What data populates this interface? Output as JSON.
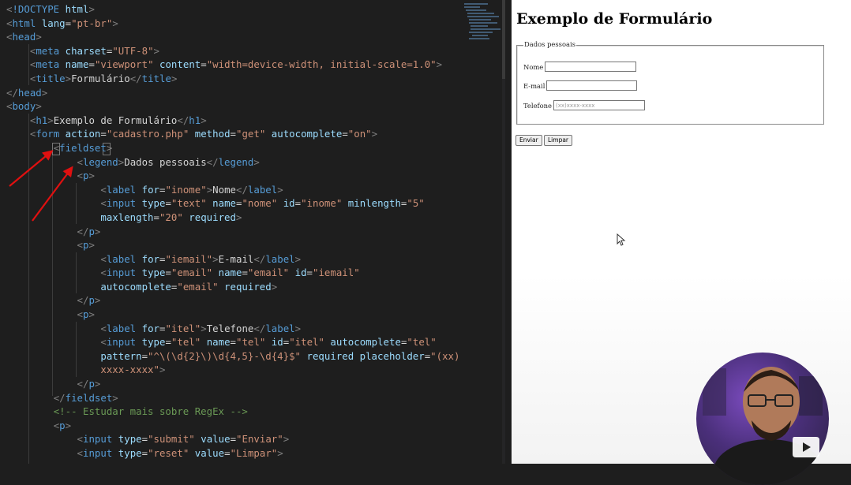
{
  "editor": {
    "lines": [
      [
        {
          "c": "p",
          "v": "<"
        },
        {
          "c": "d",
          "v": "!DOCTYPE"
        },
        {
          "c": "x",
          "v": " "
        },
        {
          "c": "a",
          "v": "html"
        },
        {
          "c": "p",
          "v": ">"
        }
      ],
      [
        {
          "c": "p",
          "v": "<"
        },
        {
          "c": "t",
          "v": "html"
        },
        {
          "c": "x",
          "v": " "
        },
        {
          "c": "a",
          "v": "lang"
        },
        {
          "c": "x",
          "v": "="
        },
        {
          "c": "s",
          "v": "\"pt-br\""
        },
        {
          "c": "p",
          "v": ">"
        }
      ],
      [
        {
          "c": "p",
          "v": "<"
        },
        {
          "c": "t",
          "v": "head"
        },
        {
          "c": "p",
          "v": ">"
        }
      ],
      [
        {
          "c": "x",
          "v": "    "
        },
        {
          "c": "p",
          "v": "<"
        },
        {
          "c": "t",
          "v": "meta"
        },
        {
          "c": "x",
          "v": " "
        },
        {
          "c": "a",
          "v": "charset"
        },
        {
          "c": "x",
          "v": "="
        },
        {
          "c": "s",
          "v": "\"UTF-8\""
        },
        {
          "c": "p",
          "v": ">"
        }
      ],
      [
        {
          "c": "x",
          "v": "    "
        },
        {
          "c": "p",
          "v": "<"
        },
        {
          "c": "t",
          "v": "meta"
        },
        {
          "c": "x",
          "v": " "
        },
        {
          "c": "a",
          "v": "name"
        },
        {
          "c": "x",
          "v": "="
        },
        {
          "c": "s",
          "v": "\"viewport\""
        },
        {
          "c": "x",
          "v": " "
        },
        {
          "c": "a",
          "v": "content"
        },
        {
          "c": "x",
          "v": "="
        },
        {
          "c": "s",
          "v": "\"width=device-width, initial-scale=1.0\""
        },
        {
          "c": "p",
          "v": ">"
        }
      ],
      [
        {
          "c": "x",
          "v": "    "
        },
        {
          "c": "p",
          "v": "<"
        },
        {
          "c": "t",
          "v": "title"
        },
        {
          "c": "p",
          "v": ">"
        },
        {
          "c": "x",
          "v": "Formulário"
        },
        {
          "c": "p",
          "v": "</"
        },
        {
          "c": "t",
          "v": "title"
        },
        {
          "c": "p",
          "v": ">"
        }
      ],
      [
        {
          "c": "p",
          "v": "</"
        },
        {
          "c": "t",
          "v": "head"
        },
        {
          "c": "p",
          "v": ">"
        }
      ],
      [
        {
          "c": "p",
          "v": "<"
        },
        {
          "c": "t",
          "v": "body"
        },
        {
          "c": "p",
          "v": ">"
        }
      ],
      [
        {
          "c": "x",
          "v": "    "
        },
        {
          "c": "p",
          "v": "<"
        },
        {
          "c": "t",
          "v": "h1"
        },
        {
          "c": "p",
          "v": ">"
        },
        {
          "c": "x",
          "v": "Exemplo de Formulário"
        },
        {
          "c": "p",
          "v": "</"
        },
        {
          "c": "t",
          "v": "h1"
        },
        {
          "c": "p",
          "v": ">"
        }
      ],
      [
        {
          "c": "x",
          "v": "    "
        },
        {
          "c": "p",
          "v": "<"
        },
        {
          "c": "t",
          "v": "form"
        },
        {
          "c": "x",
          "v": " "
        },
        {
          "c": "a",
          "v": "action"
        },
        {
          "c": "x",
          "v": "="
        },
        {
          "c": "s",
          "v": "\"cadastro.php\""
        },
        {
          "c": "x",
          "v": " "
        },
        {
          "c": "a",
          "v": "method"
        },
        {
          "c": "x",
          "v": "="
        },
        {
          "c": "s",
          "v": "\"get\""
        },
        {
          "c": "x",
          "v": " "
        },
        {
          "c": "a",
          "v": "autocomplete"
        },
        {
          "c": "x",
          "v": "="
        },
        {
          "c": "s",
          "v": "\"on\""
        },
        {
          "c": "p",
          "v": ">"
        }
      ],
      [
        {
          "c": "x",
          "v": "        "
        },
        {
          "c": "p",
          "v": "<"
        },
        {
          "c": "t",
          "v": "fieldset"
        },
        {
          "c": "p",
          "v": ">"
        }
      ],
      [
        {
          "c": "x",
          "v": "            "
        },
        {
          "c": "p",
          "v": "<"
        },
        {
          "c": "t",
          "v": "legend"
        },
        {
          "c": "p",
          "v": ">"
        },
        {
          "c": "x",
          "v": "Dados pessoais"
        },
        {
          "c": "p",
          "v": "</"
        },
        {
          "c": "t",
          "v": "legend"
        },
        {
          "c": "p",
          "v": ">"
        }
      ],
      [
        {
          "c": "x",
          "v": "            "
        },
        {
          "c": "p",
          "v": "<"
        },
        {
          "c": "t",
          "v": "p"
        },
        {
          "c": "p",
          "v": ">"
        }
      ],
      [
        {
          "c": "x",
          "v": "                "
        },
        {
          "c": "p",
          "v": "<"
        },
        {
          "c": "t",
          "v": "label"
        },
        {
          "c": "x",
          "v": " "
        },
        {
          "c": "a",
          "v": "for"
        },
        {
          "c": "x",
          "v": "="
        },
        {
          "c": "s",
          "v": "\"inome\""
        },
        {
          "c": "p",
          "v": ">"
        },
        {
          "c": "x",
          "v": "Nome"
        },
        {
          "c": "p",
          "v": "</"
        },
        {
          "c": "t",
          "v": "label"
        },
        {
          "c": "p",
          "v": ">"
        }
      ],
      [
        {
          "c": "x",
          "v": "                "
        },
        {
          "c": "p",
          "v": "<"
        },
        {
          "c": "t",
          "v": "input"
        },
        {
          "c": "x",
          "v": " "
        },
        {
          "c": "a",
          "v": "type"
        },
        {
          "c": "x",
          "v": "="
        },
        {
          "c": "s",
          "v": "\"text\""
        },
        {
          "c": "x",
          "v": " "
        },
        {
          "c": "a",
          "v": "name"
        },
        {
          "c": "x",
          "v": "="
        },
        {
          "c": "s",
          "v": "\"nome\""
        },
        {
          "c": "x",
          "v": " "
        },
        {
          "c": "a",
          "v": "id"
        },
        {
          "c": "x",
          "v": "="
        },
        {
          "c": "s",
          "v": "\"inome\""
        },
        {
          "c": "x",
          "v": " "
        },
        {
          "c": "a",
          "v": "minlength"
        },
        {
          "c": "x",
          "v": "="
        },
        {
          "c": "s",
          "v": "\"5\""
        }
      ],
      [
        {
          "c": "x",
          "v": "                "
        },
        {
          "c": "a",
          "v": "maxlength"
        },
        {
          "c": "x",
          "v": "="
        },
        {
          "c": "s",
          "v": "\"20\""
        },
        {
          "c": "x",
          "v": " "
        },
        {
          "c": "a",
          "v": "required"
        },
        {
          "c": "p",
          "v": ">"
        }
      ],
      [
        {
          "c": "x",
          "v": "            "
        },
        {
          "c": "p",
          "v": "</"
        },
        {
          "c": "t",
          "v": "p"
        },
        {
          "c": "p",
          "v": ">"
        }
      ],
      [
        {
          "c": "x",
          "v": "            "
        },
        {
          "c": "p",
          "v": "<"
        },
        {
          "c": "t",
          "v": "p"
        },
        {
          "c": "p",
          "v": ">"
        }
      ],
      [
        {
          "c": "x",
          "v": "                "
        },
        {
          "c": "p",
          "v": "<"
        },
        {
          "c": "t",
          "v": "label"
        },
        {
          "c": "x",
          "v": " "
        },
        {
          "c": "a",
          "v": "for"
        },
        {
          "c": "x",
          "v": "="
        },
        {
          "c": "s",
          "v": "\"iemail\""
        },
        {
          "c": "p",
          "v": ">"
        },
        {
          "c": "x",
          "v": "E-mail"
        },
        {
          "c": "p",
          "v": "</"
        },
        {
          "c": "t",
          "v": "label"
        },
        {
          "c": "p",
          "v": ">"
        }
      ],
      [
        {
          "c": "x",
          "v": "                "
        },
        {
          "c": "p",
          "v": "<"
        },
        {
          "c": "t",
          "v": "input"
        },
        {
          "c": "x",
          "v": " "
        },
        {
          "c": "a",
          "v": "type"
        },
        {
          "c": "x",
          "v": "="
        },
        {
          "c": "s",
          "v": "\"email\""
        },
        {
          "c": "x",
          "v": " "
        },
        {
          "c": "a",
          "v": "name"
        },
        {
          "c": "x",
          "v": "="
        },
        {
          "c": "s",
          "v": "\"email\""
        },
        {
          "c": "x",
          "v": " "
        },
        {
          "c": "a",
          "v": "id"
        },
        {
          "c": "x",
          "v": "="
        },
        {
          "c": "s",
          "v": "\"iemail\""
        }
      ],
      [
        {
          "c": "x",
          "v": "                "
        },
        {
          "c": "a",
          "v": "autocomplete"
        },
        {
          "c": "x",
          "v": "="
        },
        {
          "c": "s",
          "v": "\"email\""
        },
        {
          "c": "x",
          "v": " "
        },
        {
          "c": "a",
          "v": "required"
        },
        {
          "c": "p",
          "v": ">"
        }
      ],
      [
        {
          "c": "x",
          "v": "            "
        },
        {
          "c": "p",
          "v": "</"
        },
        {
          "c": "t",
          "v": "p"
        },
        {
          "c": "p",
          "v": ">"
        }
      ],
      [
        {
          "c": "x",
          "v": "            "
        },
        {
          "c": "p",
          "v": "<"
        },
        {
          "c": "t",
          "v": "p"
        },
        {
          "c": "p",
          "v": ">"
        }
      ],
      [
        {
          "c": "x",
          "v": "                "
        },
        {
          "c": "p",
          "v": "<"
        },
        {
          "c": "t",
          "v": "label"
        },
        {
          "c": "x",
          "v": " "
        },
        {
          "c": "a",
          "v": "for"
        },
        {
          "c": "x",
          "v": "="
        },
        {
          "c": "s",
          "v": "\"itel\""
        },
        {
          "c": "p",
          "v": ">"
        },
        {
          "c": "x",
          "v": "Telefone"
        },
        {
          "c": "p",
          "v": "</"
        },
        {
          "c": "t",
          "v": "label"
        },
        {
          "c": "p",
          "v": ">"
        }
      ],
      [
        {
          "c": "x",
          "v": "                "
        },
        {
          "c": "p",
          "v": "<"
        },
        {
          "c": "t",
          "v": "input"
        },
        {
          "c": "x",
          "v": " "
        },
        {
          "c": "a",
          "v": "type"
        },
        {
          "c": "x",
          "v": "="
        },
        {
          "c": "s",
          "v": "\"tel\""
        },
        {
          "c": "x",
          "v": " "
        },
        {
          "c": "a",
          "v": "name"
        },
        {
          "c": "x",
          "v": "="
        },
        {
          "c": "s",
          "v": "\"tel\""
        },
        {
          "c": "x",
          "v": " "
        },
        {
          "c": "a",
          "v": "id"
        },
        {
          "c": "x",
          "v": "="
        },
        {
          "c": "s",
          "v": "\"itel\""
        },
        {
          "c": "x",
          "v": " "
        },
        {
          "c": "a",
          "v": "autocomplete"
        },
        {
          "c": "x",
          "v": "="
        },
        {
          "c": "s",
          "v": "\"tel\""
        }
      ],
      [
        {
          "c": "x",
          "v": "                "
        },
        {
          "c": "a",
          "v": "pattern"
        },
        {
          "c": "x",
          "v": "="
        },
        {
          "c": "s",
          "v": "\"^\\(\\d{2}\\)\\d{4,5}-\\d{4}$\""
        },
        {
          "c": "x",
          "v": " "
        },
        {
          "c": "a",
          "v": "required"
        },
        {
          "c": "x",
          "v": " "
        },
        {
          "c": "a",
          "v": "placeholder"
        },
        {
          "c": "x",
          "v": "="
        },
        {
          "c": "s",
          "v": "\"(xx)"
        }
      ],
      [
        {
          "c": "x",
          "v": "                "
        },
        {
          "c": "s",
          "v": "xxxx-xxxx\""
        },
        {
          "c": "p",
          "v": ">"
        }
      ],
      [
        {
          "c": "x",
          "v": "            "
        },
        {
          "c": "p",
          "v": "</"
        },
        {
          "c": "t",
          "v": "p"
        },
        {
          "c": "p",
          "v": ">"
        }
      ],
      [
        {
          "c": "x",
          "v": "        "
        },
        {
          "c": "p",
          "v": "</"
        },
        {
          "c": "t",
          "v": "fieldset"
        },
        {
          "c": "p",
          "v": ">"
        }
      ],
      [
        {
          "c": "x",
          "v": "        "
        },
        {
          "c": "c",
          "v": "<!-- Estudar mais sobre RegEx -->"
        }
      ],
      [
        {
          "c": "x",
          "v": "        "
        },
        {
          "c": "p",
          "v": "<"
        },
        {
          "c": "t",
          "v": "p"
        },
        {
          "c": "p",
          "v": ">"
        }
      ],
      [
        {
          "c": "x",
          "v": "            "
        },
        {
          "c": "p",
          "v": "<"
        },
        {
          "c": "t",
          "v": "input"
        },
        {
          "c": "x",
          "v": " "
        },
        {
          "c": "a",
          "v": "type"
        },
        {
          "c": "x",
          "v": "="
        },
        {
          "c": "s",
          "v": "\"submit\""
        },
        {
          "c": "x",
          "v": " "
        },
        {
          "c": "a",
          "v": "value"
        },
        {
          "c": "x",
          "v": "="
        },
        {
          "c": "s",
          "v": "\"Enviar\""
        },
        {
          "c": "p",
          "v": ">"
        }
      ],
      [
        {
          "c": "x",
          "v": "            "
        },
        {
          "c": "p",
          "v": "<"
        },
        {
          "c": "t",
          "v": "input"
        },
        {
          "c": "x",
          "v": " "
        },
        {
          "c": "a",
          "v": "type"
        },
        {
          "c": "x",
          "v": "="
        },
        {
          "c": "s",
          "v": "\"reset\""
        },
        {
          "c": "x",
          "v": " "
        },
        {
          "c": "a",
          "v": "value"
        },
        {
          "c": "x",
          "v": "="
        },
        {
          "c": "s",
          "v": "\"Limpar\""
        },
        {
          "c": "p",
          "v": ">"
        }
      ]
    ],
    "colors": {
      "background": "#1e1e1e",
      "tag": "#569cd6",
      "attribute": "#9cdcfe",
      "string": "#ce9178",
      "comment": "#6a9955",
      "annotation_arrow": "#e01010"
    }
  },
  "preview": {
    "heading": "Exemplo de Formulário",
    "legend": "Dados pessoais",
    "fields": {
      "nome_label": "Nome",
      "email_label": "E-mail",
      "tel_label": "Telefone",
      "tel_placeholder": "(xx)xxxx-xxxx"
    },
    "submit_label": "Enviar",
    "reset_label": "Limpar"
  },
  "overlay": {
    "webcam": "presenter-webcam",
    "play_icon": "play-icon"
  }
}
